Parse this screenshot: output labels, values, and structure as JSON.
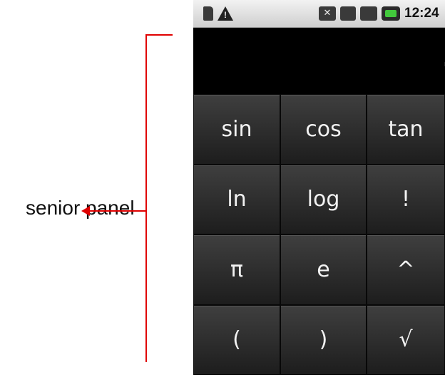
{
  "annotation": {
    "label": "senior panel",
    "line_color": "#e00000"
  },
  "status_bar": {
    "time": "12:24",
    "icons": [
      "sd-card-icon",
      "warning-icon",
      "mute-icon",
      "data-icon",
      "signal-icon",
      "battery-icon"
    ]
  },
  "display": {
    "value": "."
  },
  "keys": [
    {
      "name": "sin-key",
      "label": "sin"
    },
    {
      "name": "cos-key",
      "label": "cos"
    },
    {
      "name": "tan-key",
      "label": "tan"
    },
    {
      "name": "ln-key",
      "label": "ln"
    },
    {
      "name": "log-key",
      "label": "log"
    },
    {
      "name": "factorial-key",
      "label": "!"
    },
    {
      "name": "pi-key",
      "label": "π"
    },
    {
      "name": "e-key",
      "label": "e"
    },
    {
      "name": "power-key",
      "label": "^"
    },
    {
      "name": "open-paren-key",
      "label": "("
    },
    {
      "name": "close-paren-key",
      "label": ")"
    },
    {
      "name": "sqrt-key",
      "label": "√"
    }
  ],
  "colors": {
    "panel_bg": "#000000",
    "key_text": "#f2f2f2",
    "battery": "#42c83c"
  }
}
